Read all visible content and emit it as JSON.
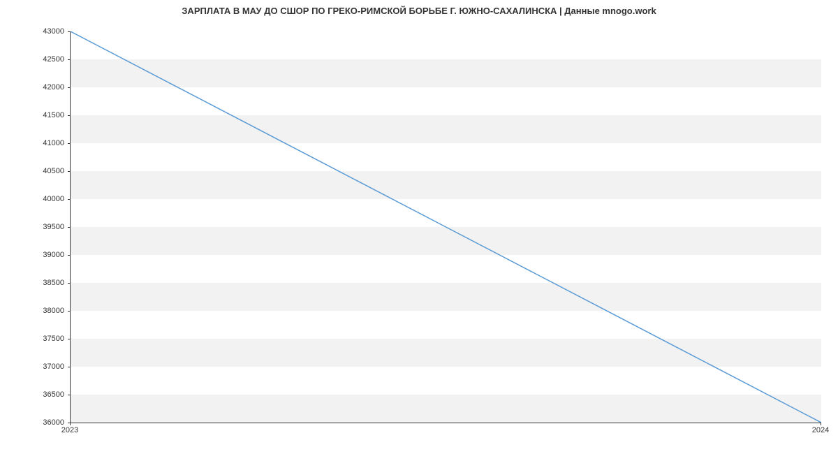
{
  "chart_data": {
    "type": "line",
    "title": "ЗАРПЛАТА В МАУ ДО СШОР ПО ГРЕКО-РИМСКОЙ БОРЬБЕ Г. ЮЖНО-САХАЛИНСКА | Данные mnogo.work",
    "xlabel": "",
    "ylabel": "",
    "x": [
      2023,
      2024
    ],
    "values": [
      43000,
      36000
    ],
    "ylim": [
      36000,
      43000
    ],
    "xlim": [
      2023,
      2024
    ],
    "y_ticks": [
      36000,
      36500,
      37000,
      37500,
      38000,
      38500,
      39000,
      39500,
      40000,
      40500,
      41000,
      41500,
      42000,
      42500,
      43000
    ],
    "x_ticks": [
      2023,
      2024
    ],
    "line_color": "#5b9bd5",
    "grid": true
  }
}
